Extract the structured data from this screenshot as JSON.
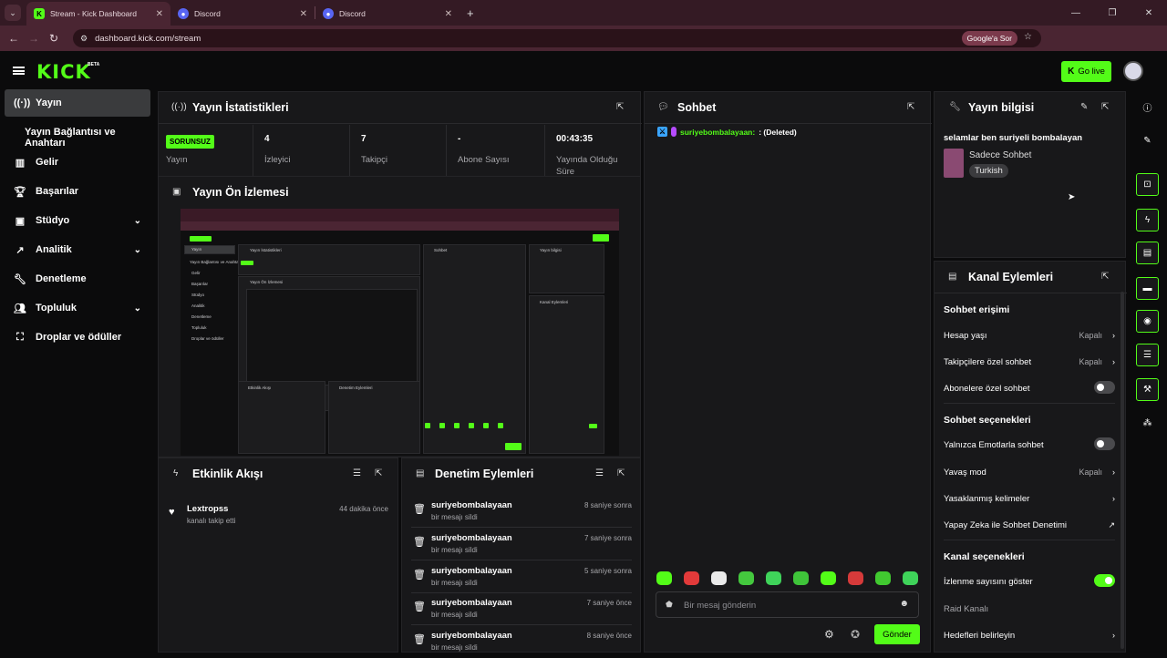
{
  "browser": {
    "tabs": [
      {
        "title": "Stream - Kick Dashboard",
        "favicon": "kick-icon",
        "active": true
      },
      {
        "title": "Discord",
        "favicon": "discord-icon",
        "active": false
      },
      {
        "title": "Discord",
        "favicon": "discord-icon",
        "active": false
      }
    ],
    "url": "dashboard.kick.com/stream",
    "google_pill": "Google'a Sor"
  },
  "header": {
    "logo": "KICK",
    "beta": "BETA",
    "go_live": "Go live"
  },
  "sidebar": {
    "items": [
      {
        "label": "Yayın",
        "icon": "broadcast-icon"
      },
      {
        "label": "Yayın Bağlantısı ve Anahtarı",
        "icon": ""
      },
      {
        "label": "Gelir",
        "icon": "chart-icon"
      },
      {
        "label": "Başarılar",
        "icon": "trophy-icon"
      },
      {
        "label": "Stüdyo",
        "icon": "studio-icon"
      },
      {
        "label": "Analitik",
        "icon": "analytics-icon"
      },
      {
        "label": "Denetleme",
        "icon": "wrench-icon"
      },
      {
        "label": "Topluluk",
        "icon": "people-icon"
      },
      {
        "label": "Droplar ve ödüller",
        "icon": "gift-icon"
      }
    ]
  },
  "stats": {
    "title": "Yayın İstatistikleri",
    "status_badge": "SORUNSUZ",
    "cells": [
      {
        "value": "",
        "label": "Yayın"
      },
      {
        "value": "4",
        "label": "İzleyici"
      },
      {
        "value": "7",
        "label": "Takipçi"
      },
      {
        "value": "-",
        "label": "Abone Sayısı"
      },
      {
        "value": "00:43:35",
        "label": "Yayında Olduğu Süre"
      }
    ]
  },
  "preview": {
    "title": "Yayın Ön İzlemesi"
  },
  "activity": {
    "title": "Etkinlik Akışı",
    "items": [
      {
        "name": "Lextropss",
        "sub": "kanalı takip etti",
        "time": "44 dakika önce"
      }
    ]
  },
  "moderation": {
    "title": "Denetim Eylemleri",
    "items": [
      {
        "name": "suriyebombalayaan",
        "sub": "bir mesajı sildi",
        "time": "8 saniye sonra"
      },
      {
        "name": "suriyebombalayaan",
        "sub": "bir mesajı sildi",
        "time": "7 saniye sonra"
      },
      {
        "name": "suriyebombalayaan",
        "sub": "bir mesajı sildi",
        "time": "5 saniye sonra"
      },
      {
        "name": "suriyebombalayaan",
        "sub": "bir mesajı sildi",
        "time": "7 saniye önce"
      },
      {
        "name": "suriyebombalayaan",
        "sub": "bir mesajı sildi",
        "time": "8 saniye önce"
      }
    ]
  },
  "chat": {
    "title": "Sohbet",
    "message_user": "suriyebombalayaan:",
    "message_text": ": (Deleted)",
    "placeholder": "Bir mesaj gönderin",
    "send": "Gönder"
  },
  "info": {
    "title": "Yayın bilgisi",
    "stream_title": "selamlar ben suriyeli bombalayan",
    "category": "Sadece Sohbet",
    "language": "Turkish"
  },
  "actions": {
    "title": "Kanal Eylemleri",
    "chat_access": "Sohbet erişimi",
    "account_age": "Hesap yaşı",
    "account_age_val": "Kapalı",
    "followers_only": "Takipçilere özel sohbet",
    "followers_only_val": "Kapalı",
    "subs_only": "Abonelere özel sohbet",
    "chat_options": "Sohbet seçenekleri",
    "emotes_only": "Yalnızca Emotlarla sohbet",
    "slow_mode": "Yavaş mod",
    "slow_mode_val": "Kapalı",
    "banned_words": "Yasaklanmış kelimeler",
    "ai_moderation": "Yapay Zeka ile Sohbet Denetimi",
    "channel_options": "Kanal seçenekleri",
    "show_viewers": "İzlenme sayısını göster",
    "raid_channel": "Raid Kanalı",
    "set_goals": "Hedefleri belirleyin"
  },
  "preview_mini": {
    "sidebar": [
      "Yayın",
      "Yayın Bağlantısı ve Anahtarı",
      "Gelir",
      "Başarılar",
      "Stüdyo",
      "Analitik",
      "Denetleme",
      "Topluluk",
      "Droplar ve ödüller"
    ],
    "stats_title": "Yayın İstatistikleri",
    "preview_title": "Yayın Ön İzlemesi",
    "chat_title": "Sohbet",
    "info_title": "Yayın bilgisi",
    "actions_title": "Kanal Eylemleri",
    "activity_title": "Etkinlik Akışı",
    "mod_title": "Denetim Eylemleri"
  }
}
